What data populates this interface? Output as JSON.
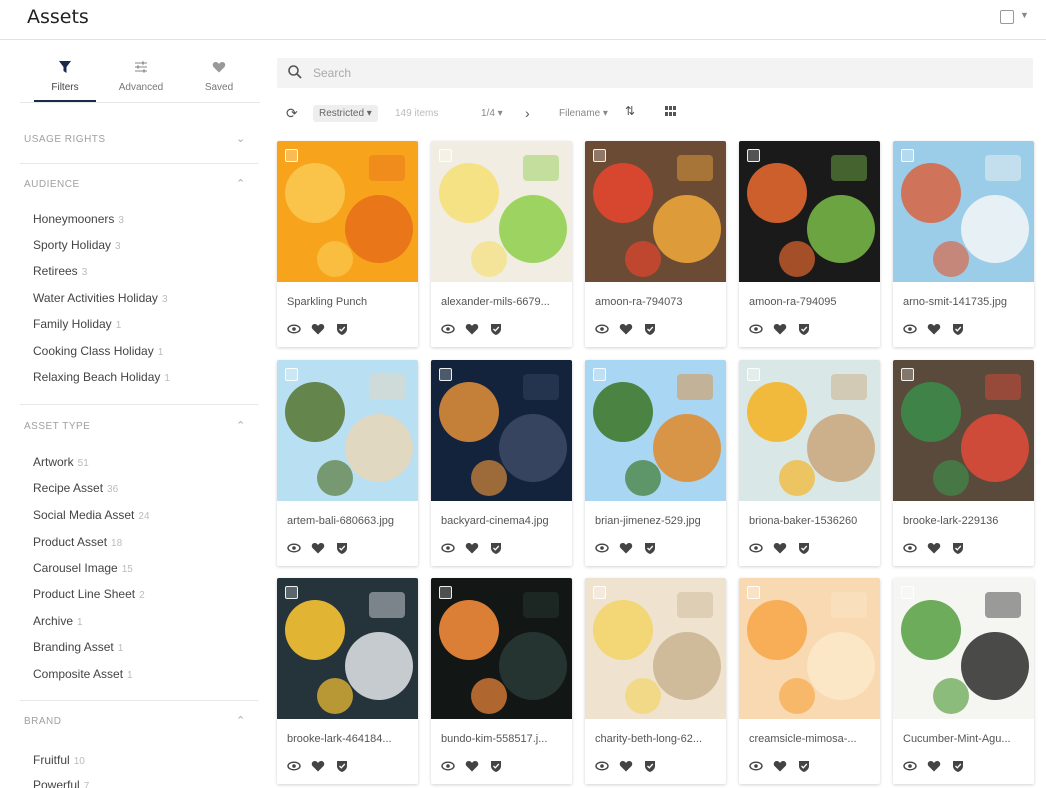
{
  "header": {
    "title": "Assets"
  },
  "tabs": [
    {
      "label": "Filters",
      "icon": "filter-icon"
    },
    {
      "label": "Advanced",
      "icon": "sliders-icon"
    },
    {
      "label": "Saved",
      "icon": "heart-icon"
    }
  ],
  "sections": [
    {
      "title": "USAGE RIGHTS",
      "expanded": false,
      "items": []
    },
    {
      "title": "AUDIENCE",
      "expanded": true,
      "items": [
        {
          "label": "Honeymooners",
          "count": "3"
        },
        {
          "label": "Sporty Holiday",
          "count": "3"
        },
        {
          "label": "Retirees",
          "count": "3"
        },
        {
          "label": "Water Activities Holiday",
          "count": "3"
        },
        {
          "label": "Family Holiday",
          "count": "1"
        },
        {
          "label": "Cooking Class Holiday",
          "count": "1"
        },
        {
          "label": "Relaxing Beach Holiday",
          "count": "1"
        }
      ]
    },
    {
      "title": "ASSET TYPE",
      "expanded": true,
      "items": [
        {
          "label": "Artwork",
          "count": "51"
        },
        {
          "label": "Recipe Asset",
          "count": "36"
        },
        {
          "label": "Social Media Asset",
          "count": "24"
        },
        {
          "label": "Product Asset",
          "count": "18"
        },
        {
          "label": "Carousel Image",
          "count": "15"
        },
        {
          "label": "Product Line Sheet",
          "count": "2"
        },
        {
          "label": "Archive",
          "count": "1"
        },
        {
          "label": "Branding Asset",
          "count": "1"
        },
        {
          "label": "Composite Asset",
          "count": "1"
        }
      ]
    },
    {
      "title": "BRAND",
      "expanded": true,
      "items": [
        {
          "label": "Fruitful",
          "count": "10"
        },
        {
          "label": "Powerful",
          "count": "7"
        }
      ]
    }
  ],
  "search": {
    "placeholder": "Search"
  },
  "toolbar": {
    "restricted": "Restricted ▾",
    "count": "149 items",
    "pager": "1/4 ▾",
    "sort": "Filename ▾",
    "sort_dir": "⇅"
  },
  "assets": [
    {
      "name": "Sparkling Punch",
      "palette": [
        "#f7a41c",
        "#f9c74f",
        "#e76f1a"
      ]
    },
    {
      "name": "alexander-mils-6679...",
      "palette": [
        "#f1ede2",
        "#f5e07a",
        "#8ecf4a"
      ]
    },
    {
      "name": "amoon-ra-794073",
      "palette": [
        "#6b4b33",
        "#e3462f",
        "#f2a93b"
      ]
    },
    {
      "name": "amoon-ra-794095",
      "palette": [
        "#1a1a1a",
        "#e0672d",
        "#7bbd4a"
      ]
    },
    {
      "name": "arno-smit-141735.jpg",
      "palette": [
        "#9ccde8",
        "#d56a4a",
        "#f4f6f6"
      ]
    },
    {
      "name": "artem-bali-680663.jpg",
      "palette": [
        "#b8dff2",
        "#5b7b3a",
        "#e8d7b8"
      ]
    },
    {
      "name": "backyard-cinema4.jpg",
      "palette": [
        "#12233b",
        "#d88a3a",
        "#3d4a66"
      ]
    },
    {
      "name": "brian-jimenez-529.jpg",
      "palette": [
        "#a9d6f2",
        "#3f7a2f",
        "#e08a2a"
      ]
    },
    {
      "name": "briona-baker-1536260",
      "palette": [
        "#d9e7e6",
        "#f4b52a",
        "#c9a67a"
      ]
    },
    {
      "name": "brooke-lark-229136",
      "palette": [
        "#5a4a3b",
        "#3d8a4a",
        "#e34a3a"
      ]
    },
    {
      "name": "brooke-lark-464184...",
      "palette": [
        "#25333b",
        "#f6c233",
        "#e2e6ea"
      ]
    },
    {
      "name": "bundo-kim-558517.j...",
      "palette": [
        "#121614",
        "#f28a3a",
        "#2a3a36"
      ]
    },
    {
      "name": "charity-beth-long-62...",
      "palette": [
        "#efe3cf",
        "#f3d46a",
        "#c9b490"
      ]
    },
    {
      "name": "creamsicle-mimosa-...",
      "palette": [
        "#f9d9b2",
        "#f6a94b",
        "#fbe7c8"
      ]
    },
    {
      "name": "Cucumber-Mint-Agu...",
      "palette": [
        "#f5f5f2",
        "#5ea44a",
        "#2c2c2c"
      ]
    }
  ]
}
